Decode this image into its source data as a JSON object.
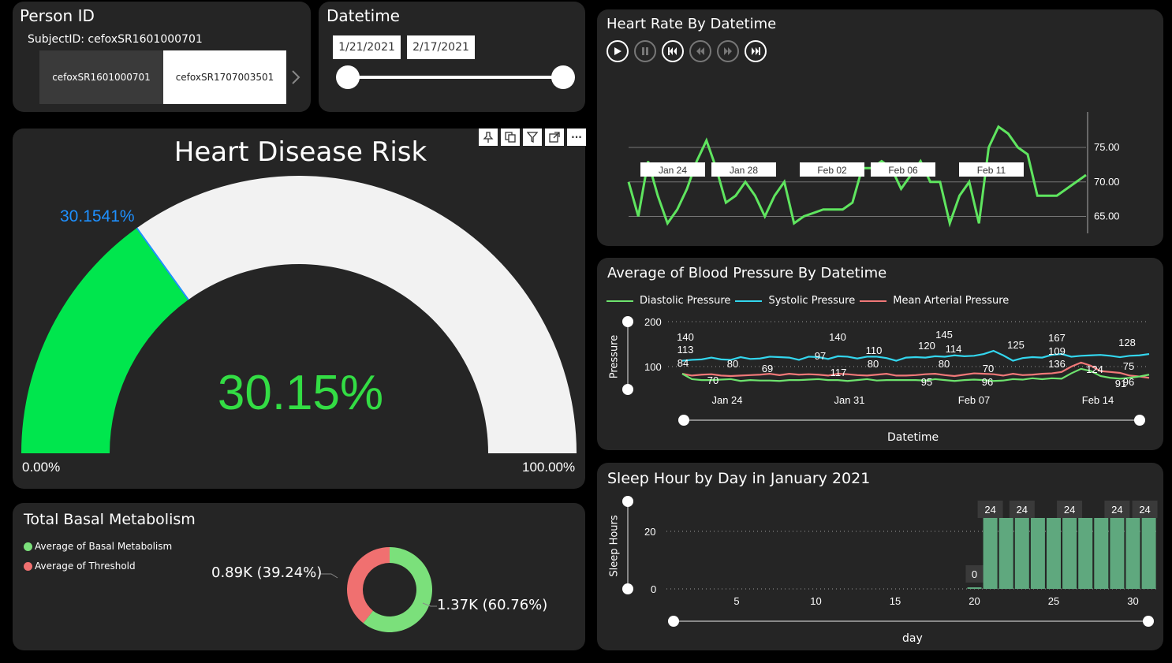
{
  "person": {
    "title": "Person ID",
    "subject_label": "SubjectID: cefoxSR1601000701",
    "options": [
      "cefoxSR1601000701",
      "cefoxSR1707003501"
    ],
    "selected": "cefoxSR1707003501",
    "chevron_icon": "chevron-right-icon"
  },
  "datetime_filter": {
    "title": "Datetime",
    "start": "1/21/2021",
    "end": "2/17/2021"
  },
  "gauge": {
    "title": "Heart Disease Risk",
    "value_label": "30.1541%",
    "center_label": "30.15%",
    "min_label": "0.00%",
    "max_label": "100.00%",
    "value": 30.1541,
    "colors": {
      "fill": "#00e64d",
      "track": "#f2f2f2",
      "marker": "#1e90ff",
      "center": "#33dd44"
    },
    "toolbar_icons": [
      "pin-icon",
      "copy-icon",
      "filter-icon",
      "focus-mode-icon",
      "more-options-icon"
    ],
    "more_label": "···"
  },
  "basal": {
    "title": "Total Basal Metabolism",
    "legend": [
      {
        "label": "Average of  Basal Metabolism",
        "color": "#7be07b"
      },
      {
        "label": "Average of Threshold",
        "color": "#f07070"
      }
    ],
    "label_threshold": "0.89K (39.24%)",
    "label_basal": "1.37K (60.76%)"
  },
  "heart_rate": {
    "title": "Heart Rate By Datetime",
    "play_icons": [
      "play-icon",
      "pause-icon",
      "skip-to-start-icon",
      "step-back-icon",
      "step-forward-icon",
      "skip-to-end-icon"
    ],
    "y_ticks": [
      "75.00",
      "70.00",
      "65.00"
    ],
    "x_labels": [
      "Jan 24",
      "Jan 28",
      "Feb 02",
      "Feb 06",
      "Feb 11"
    ]
  },
  "blood_pressure": {
    "title": "Average of Blood Pressure By Datetime",
    "y_axis_title": "Pressure",
    "x_axis_title": "Datetime",
    "y_ticks": [
      "200",
      "100"
    ],
    "x_labels": [
      "Jan 24",
      "Jan 31",
      "Feb 07",
      "Feb 14"
    ],
    "legend": [
      {
        "label": "Diastolic Pressure",
        "color": "#6ee36e"
      },
      {
        "label": "Systolic Pressure",
        "color": "#33d6ee"
      },
      {
        "label": "Mean Arterial Pressure",
        "color": "#f07878"
      }
    ],
    "data_labels": [
      "140",
      "113",
      "84",
      "70",
      "80",
      "69",
      "97",
      "140",
      "117",
      "110",
      "80",
      "120",
      "95",
      "145",
      "114",
      "80",
      "125",
      "96",
      "70",
      "167",
      "109",
      "136",
      "124",
      "91",
      "128",
      "75",
      "96"
    ]
  },
  "sleep": {
    "title": "Sleep Hour by Day in January 2021",
    "y_axis_title": "Sleep Hours",
    "x_axis_title": "day",
    "y_ticks": [
      "20",
      "0"
    ],
    "x_ticks": [
      "5",
      "10",
      "15",
      "20",
      "25",
      "30"
    ],
    "bar_labels": [
      "0",
      "24",
      "24",
      "24",
      "24",
      "24"
    ],
    "bar_color": "#5fa87e"
  },
  "chart_data": [
    {
      "type": "line",
      "title": "Heart Rate By Datetime",
      "ylim": [
        63,
        79
      ],
      "series": [
        {
          "values": [
            70,
            65,
            73,
            68,
            64,
            66,
            69,
            73,
            76,
            72,
            67,
            68,
            70,
            68,
            65,
            68,
            70,
            64,
            65,
            65.5,
            66,
            66,
            66,
            67,
            72,
            72,
            73,
            72,
            69,
            71,
            73,
            70,
            70,
            64,
            68,
            70,
            64,
            75,
            78,
            77,
            75,
            74,
            68,
            68,
            68,
            69,
            70,
            71
          ]
        }
      ]
    },
    {
      "type": "line",
      "title": "Average of Blood Pressure By Datetime",
      "ylabel": "Pressure",
      "xlabel": "Datetime",
      "ylim": [
        0,
        200
      ],
      "categories": [
        "Jan 24",
        "Jan 31",
        "Feb 07",
        "Feb 14"
      ],
      "series": [
        {
          "name": "Systolic Pressure",
          "values": [
            113,
            115,
            116,
            120,
            116,
            115,
            121,
            117,
            118,
            122,
            121,
            120,
            115,
            122,
            121,
            117,
            123,
            122,
            118,
            122,
            122,
            119,
            113,
            120,
            121,
            120,
            123,
            122,
            125,
            123,
            124,
            128,
            135,
            125,
            113,
            119,
            121,
            120,
            126,
            128,
            122,
            124,
            125,
            126,
            124,
            121,
            124,
            125,
            128
          ]
        },
        {
          "name": "Mean Arterial Pressure",
          "values": [
            84,
            80,
            82,
            83,
            80,
            79,
            80,
            81,
            82,
            84,
            81,
            84,
            82,
            83,
            82,
            80,
            84,
            83,
            81,
            80,
            82,
            84,
            80,
            80,
            81,
            83,
            84,
            81,
            79,
            82,
            85,
            84,
            83,
            80,
            84,
            81,
            82,
            84,
            85,
            88,
            100,
            109,
            102,
            90,
            88,
            86,
            80,
            78,
            75
          ]
        },
        {
          "name": "Diastolic Pressure",
          "values": [
            84,
            72,
            70,
            70,
            71,
            72,
            68,
            70,
            69,
            69,
            68,
            70,
            70,
            71,
            72,
            70,
            70,
            68,
            70,
            72,
            69,
            70,
            70,
            70,
            70,
            69,
            72,
            70,
            68,
            70,
            71,
            70,
            68,
            69,
            72,
            71,
            74,
            72,
            74,
            73,
            85,
            95,
            90,
            79,
            75,
            73,
            75,
            78,
            82
          ]
        }
      ]
    },
    {
      "type": "bar",
      "title": "Sleep Hour by Day in January 2021",
      "xlabel": "day",
      "ylabel": "Sleep Hours",
      "ylim": [
        0,
        24
      ],
      "categories": [
        20,
        21,
        22,
        23,
        24,
        25,
        26,
        27,
        28,
        29,
        30,
        31
      ],
      "values": [
        0,
        24,
        24,
        24,
        24,
        24,
        24,
        24,
        24,
        24,
        24,
        24
      ]
    },
    {
      "type": "pie",
      "title": "Total Basal Metabolism",
      "categories": [
        "Average of  Basal Metabolism",
        "Average of Threshold"
      ],
      "values": [
        1370,
        890
      ]
    }
  ]
}
